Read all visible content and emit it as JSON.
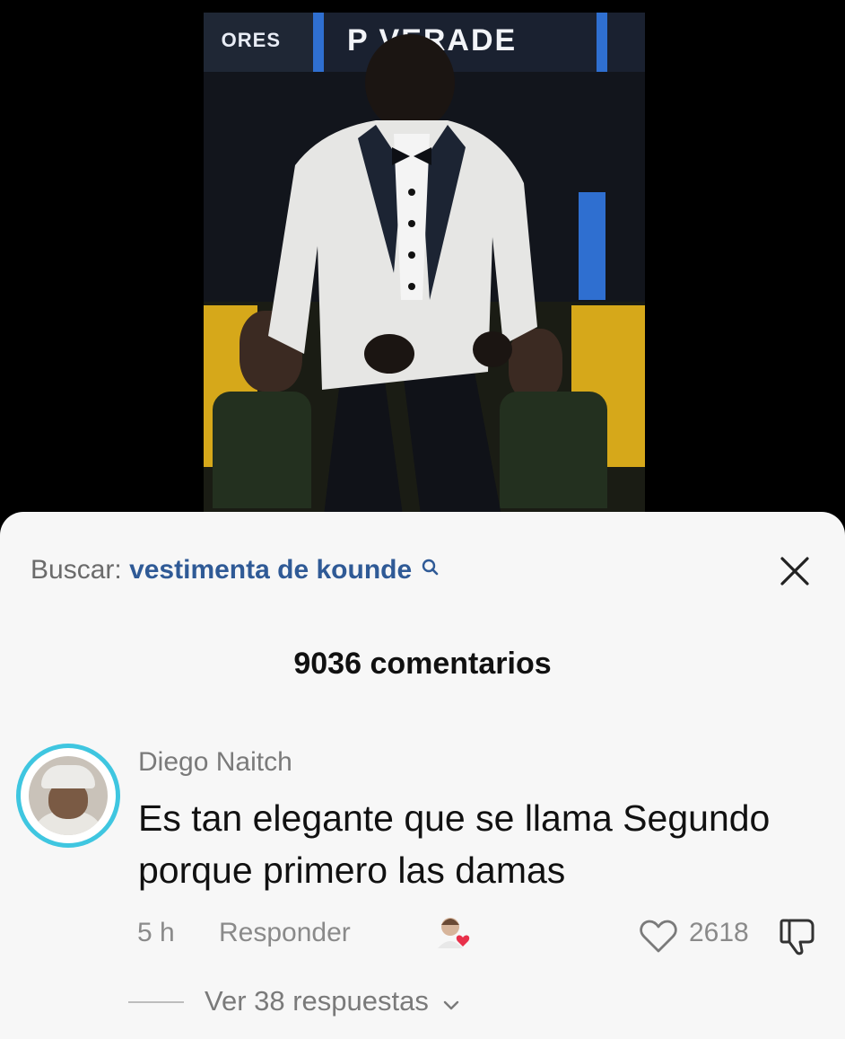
{
  "video": {
    "banner_left": "ORES",
    "banner_right": "P  VERADE"
  },
  "comments_panel": {
    "search_label": "Buscar:",
    "search_query": "vestimenta de kounde",
    "title": "9036 comentarios",
    "comment": {
      "author": "Diego Naitch",
      "text": "Es tan elegante que se llama Segundo porque primero las damas",
      "time": "5 h",
      "reply_label": "Responder",
      "likes": "2618",
      "view_replies": "Ver 38 respuestas"
    }
  },
  "colors": {
    "ring": "#3fc6e0",
    "query": "#2f5a96",
    "heart_badge": "#e8304a"
  },
  "icons": [
    "search-icon",
    "close-icon",
    "creator-liked-icon",
    "heart-icon",
    "dislike-icon",
    "chevron-down-icon"
  ]
}
